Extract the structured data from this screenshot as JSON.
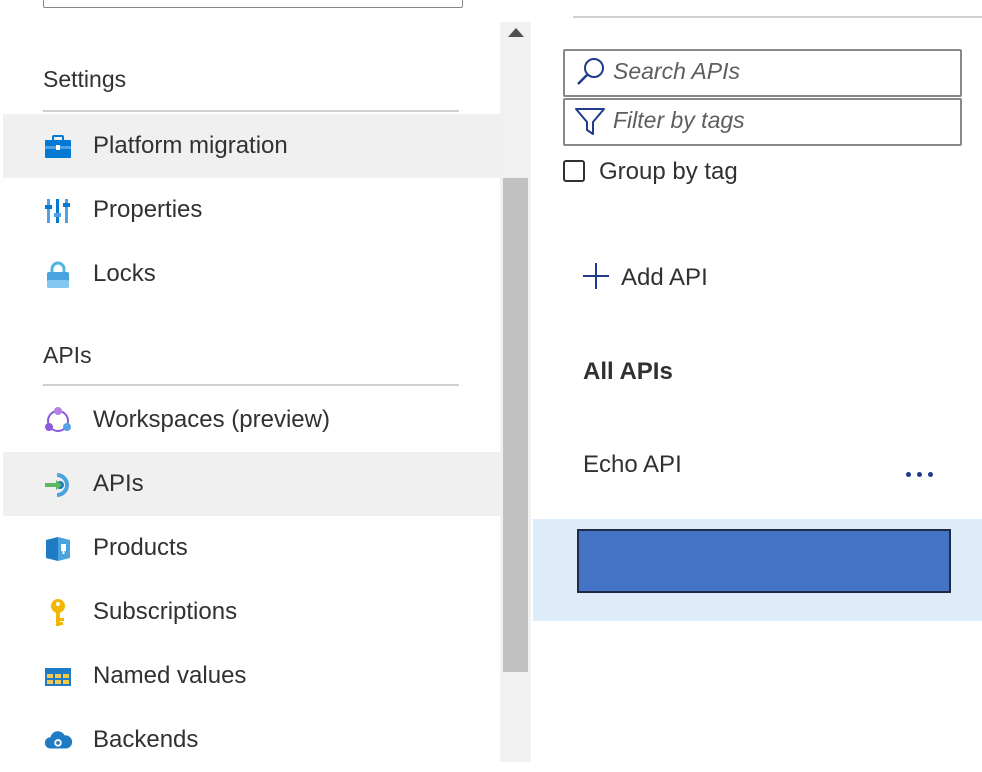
{
  "nav": {
    "settings_title": "Settings",
    "settings_items": [
      {
        "label": "Platform migration",
        "icon": "briefcase-icon",
        "highlighted": true
      },
      {
        "label": "Properties",
        "icon": "properties-icon",
        "highlighted": false
      },
      {
        "label": "Locks",
        "icon": "lock-icon",
        "highlighted": false
      }
    ],
    "apis_title": "APIs",
    "apis_items": [
      {
        "label": "Workspaces (preview)",
        "icon": "workspaces-icon",
        "highlighted": false
      },
      {
        "label": "APIs",
        "icon": "api-icon",
        "highlighted": true
      },
      {
        "label": "Products",
        "icon": "products-icon",
        "highlighted": false
      },
      {
        "label": "Subscriptions",
        "icon": "key-icon",
        "highlighted": false
      },
      {
        "label": "Named values",
        "icon": "named-values-icon",
        "highlighted": false
      },
      {
        "label": "Backends",
        "icon": "cloud-icon",
        "highlighted": false
      }
    ]
  },
  "apis_panel": {
    "search_placeholder": "Search APIs",
    "filter_placeholder": "Filter by tags",
    "group_by_tag_label": "Group by tag",
    "group_by_tag_checked": false,
    "add_api_label": "Add API",
    "all_apis_heading": "All APIs",
    "api_list": [
      {
        "name": "Echo API"
      }
    ]
  },
  "colors": {
    "highlight": "#f0f0f0",
    "selected_row": "#deecf9",
    "redaction_fill": "#4472c4",
    "accent_dots": "#1f3b8a"
  }
}
